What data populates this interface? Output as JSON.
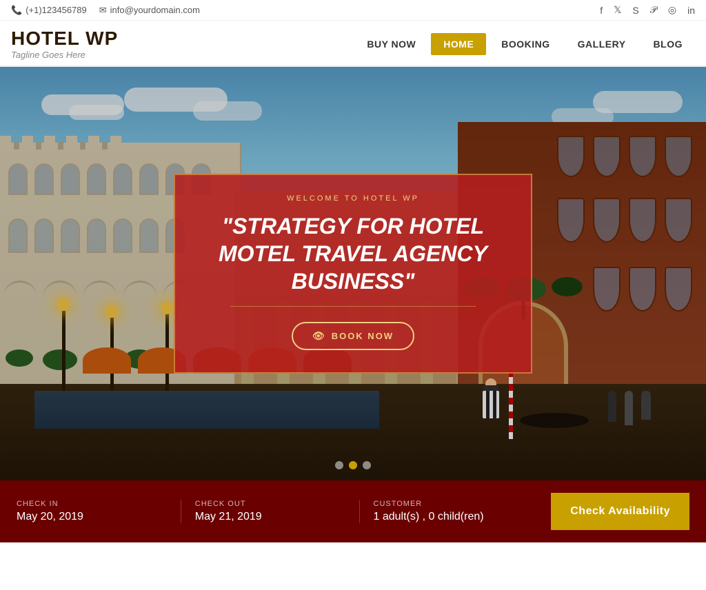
{
  "topbar": {
    "phone": "(+1)123456789",
    "email": "info@yourdomain.com",
    "phone_icon": "📞",
    "email_icon": "✉",
    "social": [
      "f",
      "𝕏",
      "𝕊",
      "𝕡",
      "𝕀",
      "in"
    ]
  },
  "header": {
    "logo_title": "HOTEL WP",
    "logo_tagline": "Tagline Goes Here"
  },
  "nav": {
    "items": [
      {
        "label": "BUY NOW",
        "active": false
      },
      {
        "label": "HOME",
        "active": true
      },
      {
        "label": "BOOKING",
        "active": false
      },
      {
        "label": "GALLERY",
        "active": false
      },
      {
        "label": "BLOG",
        "active": false
      }
    ]
  },
  "hero": {
    "subtitle": "WELCOME TO HOTEL WP",
    "title": "\"STRATEGY FOR HOTEL MOTEL TRAVEL AGENCY BUSINESS\"",
    "book_now_label": "BOOK NOW",
    "dots": [
      {
        "active": false
      },
      {
        "active": true
      },
      {
        "active": false
      }
    ]
  },
  "booking": {
    "check_in_label": "CHECK IN",
    "check_in_value": "May 20, 2019",
    "check_out_label": "CHECK OUT",
    "check_out_value": "May 21, 2019",
    "customer_label": "CUSTOMER",
    "customer_value": "1 adult(s) , 0 child(ren)",
    "check_availability_label": "Check Availability"
  },
  "colors": {
    "accent_gold": "#c8a000",
    "nav_active_bg": "#c8a000",
    "hero_overlay_bg": "rgba(180,30,30,0.88)",
    "booking_bar_bg": "#6b0000"
  }
}
